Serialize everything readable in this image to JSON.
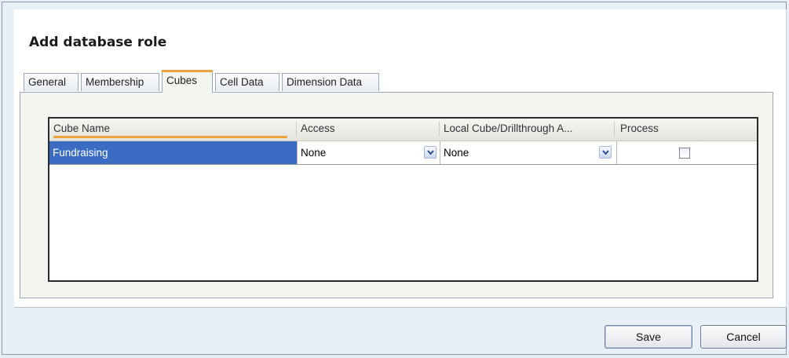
{
  "dialog": {
    "title": "Add database role"
  },
  "tabs": [
    {
      "label": "General",
      "active": false
    },
    {
      "label": "Membership",
      "active": false
    },
    {
      "label": "Cubes",
      "active": true
    },
    {
      "label": "Cell Data",
      "active": false
    },
    {
      "label": "Dimension Data",
      "active": false
    }
  ],
  "grid": {
    "columns": [
      "Cube Name",
      "Access",
      "Local Cube/Drillthrough A...",
      "Process"
    ],
    "rows": [
      {
        "cube_name": "Fundraising",
        "access": "None",
        "local_cube": "None",
        "process": false
      }
    ]
  },
  "buttons": {
    "save": "Save",
    "cancel": "Cancel"
  },
  "colors": {
    "accent_tab": "#f1a13b",
    "selection": "#3a6cc3"
  },
  "icons": {
    "dropdown": "chevron-down-icon"
  }
}
